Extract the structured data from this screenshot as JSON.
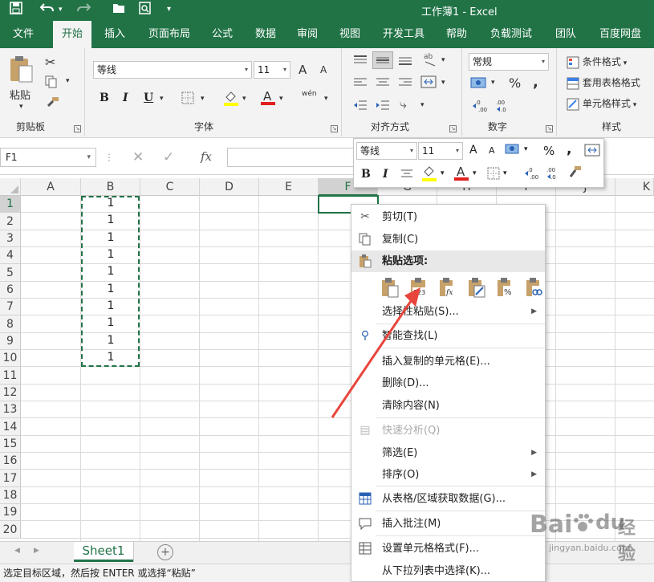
{
  "window": {
    "title": "工作薄1  -  Excel"
  },
  "tabs": [
    "文件",
    "开始",
    "插入",
    "页面布局",
    "公式",
    "数据",
    "审阅",
    "视图",
    "开发工具",
    "帮助",
    "负载测试",
    "团队",
    "百度网盘"
  ],
  "active_tab": "开始",
  "ribbon": {
    "clipboard": {
      "paste_label": "粘贴",
      "group_label": "剪贴板"
    },
    "font": {
      "font_name": "等线",
      "font_size": "11",
      "group_label": "字体",
      "bold": "B",
      "italic": "I",
      "underline": "U",
      "grow": "A",
      "shrink": "A",
      "phonetic": "wén"
    },
    "alignment": {
      "group_label": "对齐方式"
    },
    "number": {
      "format": "常规",
      "group_label": "数字",
      "percent": "%",
      "comma": ","
    },
    "styles": {
      "conditional": "条件格式",
      "table": "套用表格格式",
      "cell_styles": "单元格样式",
      "group_label": "样式"
    }
  },
  "formula_bar": {
    "name_box": "F1",
    "fx": "fx"
  },
  "grid": {
    "columns": [
      "A",
      "B",
      "C",
      "D",
      "E",
      "F",
      "G",
      "H",
      "I",
      "J",
      "K"
    ],
    "rows": [
      "1",
      "2",
      "3",
      "4",
      "5",
      "6",
      "7",
      "8",
      "9",
      "10",
      "11",
      "12",
      "13",
      "14",
      "15",
      "16",
      "17",
      "18",
      "19",
      "20"
    ],
    "column_b_values": [
      "1",
      "1",
      "1",
      "1",
      "1",
      "1",
      "1",
      "1",
      "1",
      "1"
    ]
  },
  "mini_toolbar": {
    "font_name": "等线",
    "font_size": "11",
    "percent": "%",
    "comma": ","
  },
  "context_menu": {
    "cut": "剪切(T)",
    "copy": "复制(C)",
    "paste_options": "粘贴选项:",
    "paste_special": "选择性粘贴(S)...",
    "smart_lookup": "智能查找(L)",
    "insert_copied": "插入复制的单元格(E)...",
    "delete": "删除(D)...",
    "clear": "清除内容(N)",
    "quick_analysis": "快速分析(Q)",
    "filter": "筛选(E)",
    "sort": "排序(O)",
    "get_data": "从表格/区域获取数据(G)...",
    "insert_comment": "插入批注(M)",
    "format_cells": "设置单元格格式(F)...",
    "pick_list": "从下拉列表中选择(K)..."
  },
  "sheet_tabs": [
    "Sheet1"
  ],
  "status_bar": {
    "text": "选定目标区域，然后按 ENTER 或选择“粘贴”"
  },
  "watermark": {
    "brand": "Bai",
    "brand_suffix": "du",
    "site": "jingyan.baidu.com",
    "jingyan": "经验"
  },
  "colors": {
    "excel_green": "#217346",
    "arrow_red": "#e8453c"
  }
}
